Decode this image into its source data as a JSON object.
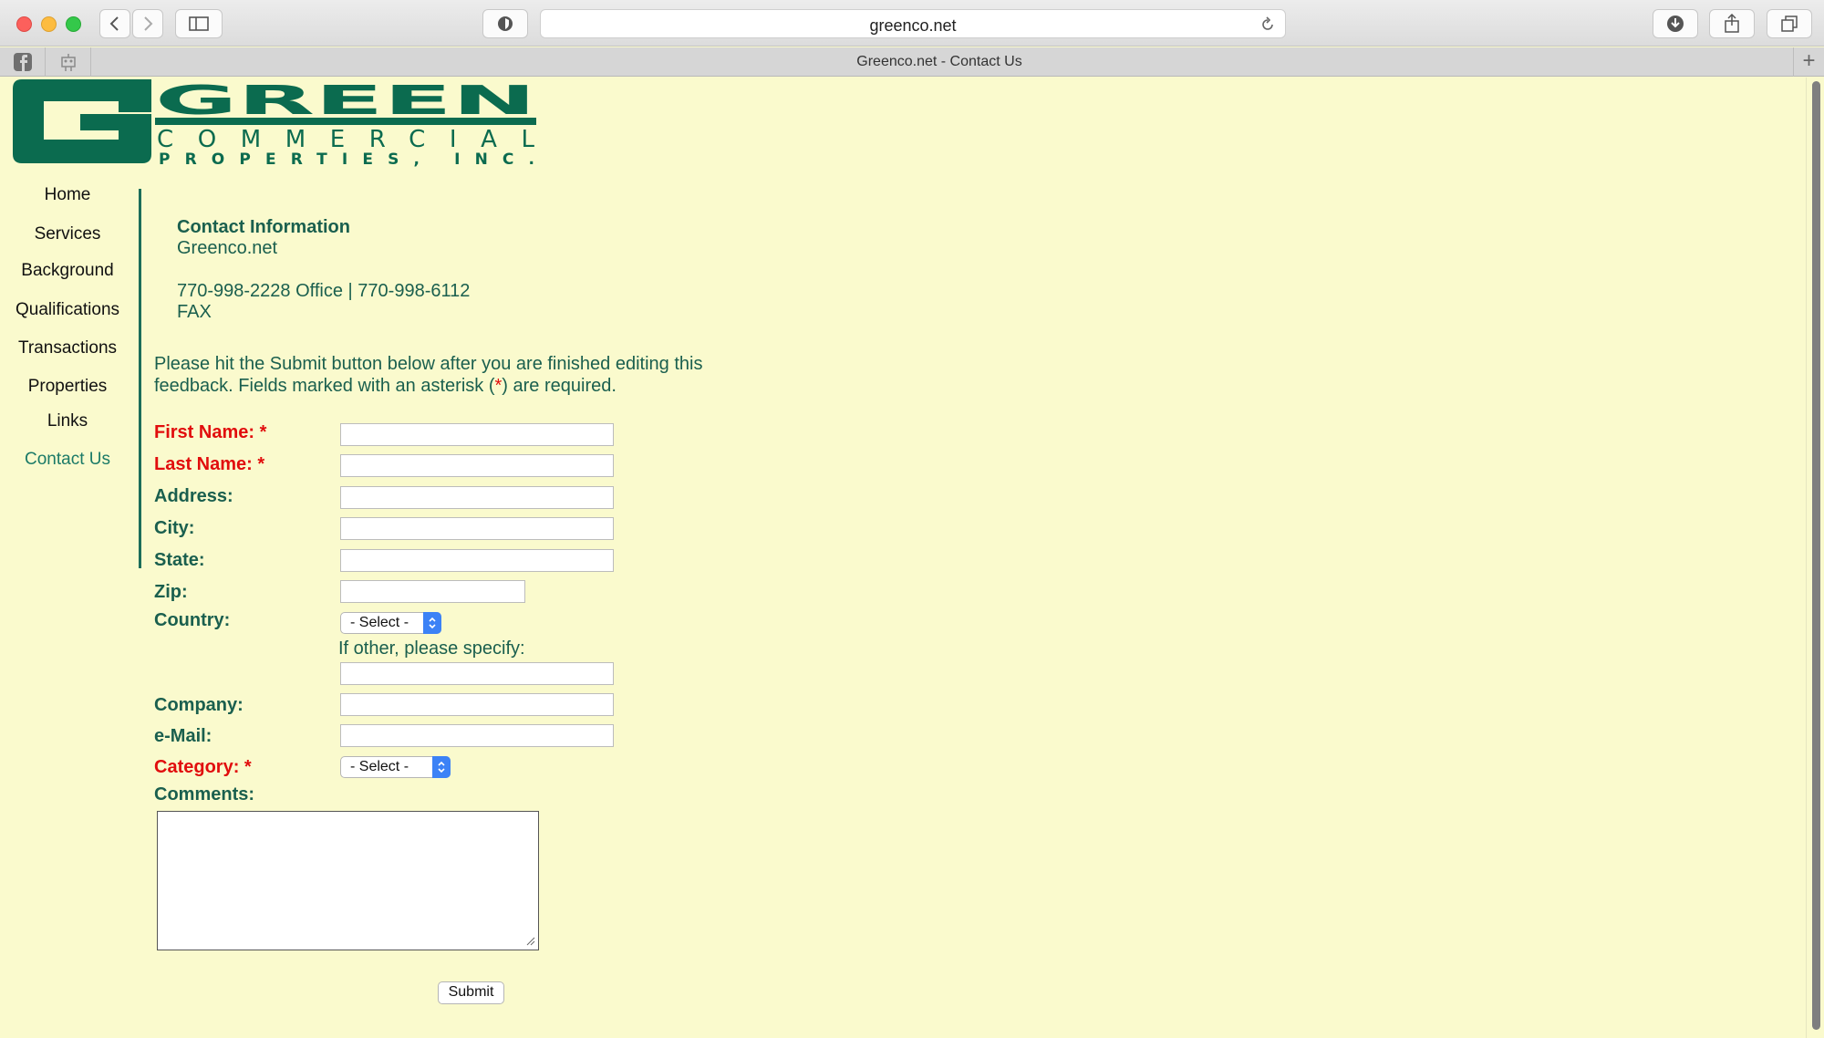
{
  "browser": {
    "url": "greenco.net",
    "tab_title": "Greenco.net - Contact Us",
    "new_tab_label": "+"
  },
  "logo": {
    "line1": "GREEN",
    "line2": "COMMERCIAL",
    "line3": "PROPERTIES, INC.",
    "color": "#0b6b4f"
  },
  "nav": {
    "items": [
      {
        "label": "Home"
      },
      {
        "label": "Services"
      },
      {
        "label": "Background"
      },
      {
        "label": "Qualifications"
      },
      {
        "label": "Transactions"
      },
      {
        "label": "Properties"
      },
      {
        "label": "Links"
      },
      {
        "label": "Contact Us",
        "active": true
      }
    ]
  },
  "contact": {
    "heading": "Contact Information",
    "site": "Greenco.net",
    "phone_line": "770-998-2228 Office | 770-998-6112",
    "fax_line": "FAX"
  },
  "intro": {
    "before_star": "Please hit the Submit button below after you are finished editing this feedback.  Fields marked with an asterisk (",
    "star": "*",
    "after_star": ") are required."
  },
  "form": {
    "first_name_label": "First Name: *",
    "last_name_label": "Last Name: *",
    "address_label": "Address:",
    "city_label": "City:",
    "state_label": "State:",
    "zip_label": "Zip:",
    "country_label": "Country:",
    "country_value": "- Select -",
    "other_specify_label": "If other, please specify:",
    "company_label": "Company:",
    "email_label": "e-Mail:",
    "category_label": "Category: *",
    "category_value": "- Select -",
    "comments_label": "Comments:",
    "submit_label": "Submit",
    "values": {
      "first_name": "",
      "last_name": "",
      "address": "",
      "city": "",
      "state": "",
      "zip": "",
      "other_country": "",
      "company": "",
      "email": "",
      "comments": ""
    }
  },
  "colors": {
    "page_background": "#fafacd",
    "text_green": "#1a5f4e",
    "required_red": "#e10d0d",
    "active_link": "#1b7a67"
  }
}
